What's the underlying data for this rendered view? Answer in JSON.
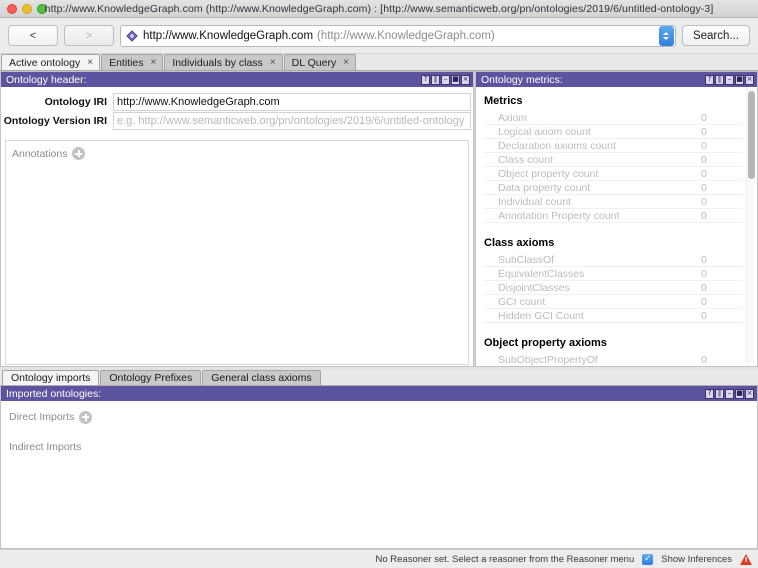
{
  "window": {
    "title": "http://www.KnowledgeGraph.com (http://www.KnowledgeGraph.com)  : [http://www.semanticweb.org/pn/ontologies/2019/6/untitled-ontology-3]",
    "close_label": "close",
    "minimize_label": "minimize",
    "zoom_label": "zoom"
  },
  "toolbar": {
    "back_label": "<",
    "forward_label": ">",
    "url_main": "http://www.KnowledgeGraph.com",
    "url_sub": "(http://www.KnowledgeGraph.com)",
    "search_label": "Search..."
  },
  "tabs": [
    {
      "label": "Active ontology",
      "close": "×",
      "active": true
    },
    {
      "label": "Entities",
      "close": "×",
      "active": false
    },
    {
      "label": "Individuals by class",
      "close": "×",
      "active": false
    },
    {
      "label": "DL Query",
      "close": "×",
      "active": false
    }
  ],
  "panel_buttons": {
    "help": "?",
    "split": "‖",
    "minimize": "–",
    "maximize": "■",
    "close": "×"
  },
  "ontology_header": {
    "title": "Ontology header:",
    "iri_label": "Ontology IRI",
    "iri_value": "http://www.KnowledgeGraph.com",
    "version_label": "Ontology Version IRI",
    "version_placeholder": "e.g. http://www.semanticweb.org/pn/ontologies/2019/6/untitled-ontology",
    "annotations_label": "Annotations",
    "add_annotation_label": "+"
  },
  "ontology_metrics": {
    "title": "Ontology metrics:",
    "sections": [
      {
        "heading": "Metrics",
        "rows": [
          {
            "name": "Axiom",
            "value": "0"
          },
          {
            "name": "Logical axiom count",
            "value": "0"
          },
          {
            "name": "Declaration axioms count",
            "value": "0"
          },
          {
            "name": "Class count",
            "value": "0"
          },
          {
            "name": "Object property count",
            "value": "0"
          },
          {
            "name": "Data property count",
            "value": "0"
          },
          {
            "name": "Individual count",
            "value": "0"
          },
          {
            "name": "Annotation Property count",
            "value": "0"
          }
        ]
      },
      {
        "heading": "Class axioms",
        "rows": [
          {
            "name": "SubClassOf",
            "value": "0"
          },
          {
            "name": "EquivalentClasses",
            "value": "0"
          },
          {
            "name": "DisjointClasses",
            "value": "0"
          },
          {
            "name": "GCI count",
            "value": "0"
          },
          {
            "name": "Hidden GCI Count",
            "value": "0"
          }
        ]
      },
      {
        "heading": "Object property axioms",
        "rows": [
          {
            "name": "SubObjectPropertyOf",
            "value": "0"
          }
        ]
      }
    ]
  },
  "bottom_tabs": [
    {
      "label": "Ontology imports",
      "active": true
    },
    {
      "label": "Ontology Prefixes",
      "active": false
    },
    {
      "label": "General class axioms",
      "active": false
    }
  ],
  "imported_ontologies": {
    "title": "Imported ontologies:",
    "direct_label": "Direct Imports",
    "add_direct_label": "+",
    "indirect_label": "Indirect Imports"
  },
  "status": {
    "reasoner_message": "No Reasoner set. Select a reasoner from the Reasoner menu",
    "show_inferences_label": "Show Inferences",
    "show_inferences_checked": true,
    "checkmark": "✓",
    "warning_label": "!"
  },
  "colors": {
    "panel_title_bg": "#5d54a0",
    "accent_blue": "#2f7fdc",
    "warning_red": "#dc3a23"
  }
}
